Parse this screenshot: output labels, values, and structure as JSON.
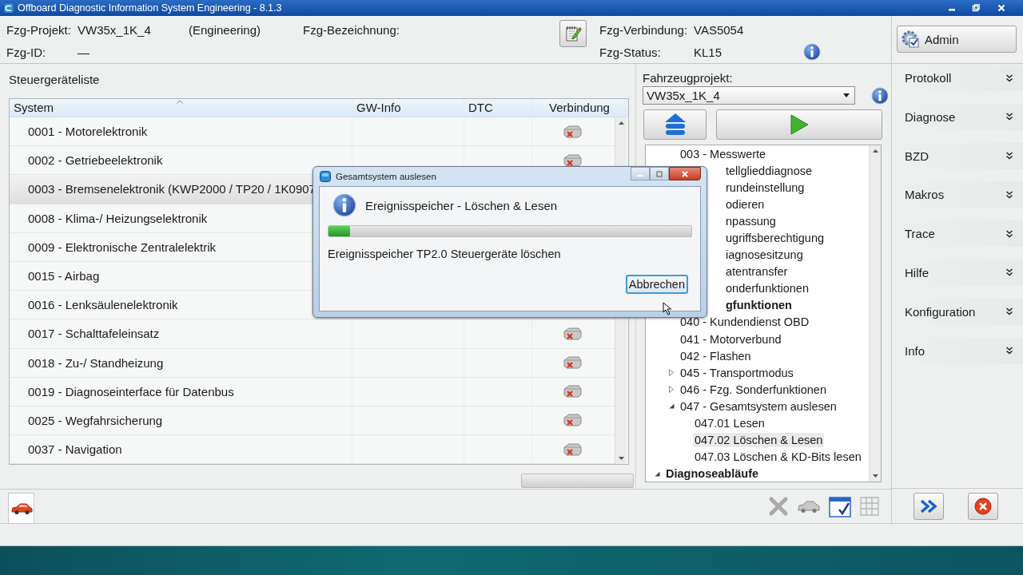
{
  "window": {
    "title": "Offboard Diagnostic Information System Engineering - 8.1.3"
  },
  "vehicle": {
    "project_label": "Fzg-Projekt:",
    "project": "VW35x_1K_4",
    "mode": "(Engineering)",
    "name_label": "Fzg-Bezeichnung:",
    "id_label": "Fzg-ID:",
    "id": "—",
    "connection_label": "Fzg-Verbindung:",
    "connection": "VAS5054",
    "status_label": "Fzg-Status:",
    "status": "KL15"
  },
  "admin_button": "Admin",
  "control_units": {
    "title": "Steuergeräteliste",
    "columns": [
      "System",
      "GW-Info",
      "DTC",
      "Verbindung"
    ],
    "rows": [
      {
        "system": "0001 - Motorelektronik",
        "selected": false,
        "connection_icon": true
      },
      {
        "system": "0002 - Getriebeelektronik",
        "selected": false,
        "connection_icon": true
      },
      {
        "system": "0003 - Bremsenelektronik  (KWP2000 / TP20 / 1K0907",
        "selected": true,
        "connection_icon": false
      },
      {
        "system": "0008 - Klima-/ Heizungselektronik",
        "selected": false,
        "connection_icon": false
      },
      {
        "system": "0009 - Elektronische Zentralelektrik",
        "selected": false,
        "connection_icon": false
      },
      {
        "system": "0015 - Airbag",
        "selected": false,
        "connection_icon": false
      },
      {
        "system": "0016 - Lenksäulenelektronik",
        "selected": false,
        "connection_icon": false
      },
      {
        "system": "0017 - Schalttafeleinsatz",
        "selected": false,
        "connection_icon": true
      },
      {
        "system": "0018 - Zu-/ Standheizung",
        "selected": false,
        "connection_icon": true
      },
      {
        "system": "0019 - Diagnoseinterface für Datenbus",
        "selected": false,
        "connection_icon": true
      },
      {
        "system": "0025 - Wegfahrsicherung",
        "selected": false,
        "connection_icon": true
      },
      {
        "system": "0037 - Navigation",
        "selected": false,
        "connection_icon": true
      }
    ]
  },
  "project_panel": {
    "label": "Fahrzeugprojekt:",
    "value": "VW35x_1K_4"
  },
  "tree": [
    {
      "children": [
        {
          "label": "003 - Messwerte",
          "covered": false,
          "selected": false
        },
        {
          "label": "tellglieddiagnose",
          "covered": true,
          "selected": false
        },
        {
          "label": "rundeinstellung",
          "covered": true,
          "selected": false
        },
        {
          "label": "odieren",
          "covered": true,
          "selected": false
        },
        {
          "label": "npassung",
          "covered": true,
          "selected": false
        },
        {
          "label": "ugriffsberechtigung",
          "covered": true,
          "selected": false
        },
        {
          "label": "iagnosesitzung",
          "covered": true,
          "selected": false
        },
        {
          "label": "atentransfer",
          "covered": true,
          "selected": false
        },
        {
          "label": "onderfunktionen",
          "covered": true,
          "selected": false
        }
      ]
    },
    {
      "label": "gfunktionen",
      "covered": true,
      "selected": false,
      "children": [
        {
          "label": "040 - Kundendienst OBD",
          "covered": false,
          "selected": false
        },
        {
          "label": "041 - Motorverbund",
          "covered": false,
          "selected": false
        },
        {
          "label": "042 - Flashen",
          "covered": false,
          "selected": false
        },
        {
          "label": "045 - Transportmodus",
          "covered": false,
          "selected": false,
          "expanded": false
        },
        {
          "label": "046 - Fzg. Sonderfunktionen",
          "covered": false,
          "selected": false,
          "expanded": false
        },
        {
          "label": "047 - Gesamtsystem auslesen",
          "covered": false,
          "selected": false,
          "expanded": true,
          "children": [
            {
              "label": "047.01 Lesen",
              "covered": false,
              "selected": false
            },
            {
              "label": "047.02 Löschen & Lesen",
              "covered": false,
              "selected": true
            },
            {
              "label": "047.03 Löschen & KD-Bits lesen",
              "covered": false,
              "selected": false
            }
          ]
        }
      ]
    },
    {
      "label": "Diagnoseabläufe",
      "covered": false,
      "selected": false,
      "expanded": true
    }
  ],
  "menu": [
    {
      "label": "Protokoll"
    },
    {
      "label": "Diagnose"
    },
    {
      "label": "BZD"
    },
    {
      "label": "Makros"
    },
    {
      "label": "Trace"
    },
    {
      "label": "Hilfe"
    },
    {
      "label": "Konfiguration"
    },
    {
      "label": "Info"
    }
  ],
  "dialog": {
    "title": "Gesamtsystem auslesen",
    "heading": "Ereignisspeicher - Löschen & Lesen",
    "level": 0.06,
    "message": "Ereignisspeicher TP2.0 Steuergeräte löschen",
    "cancel": "Abbrechen"
  }
}
